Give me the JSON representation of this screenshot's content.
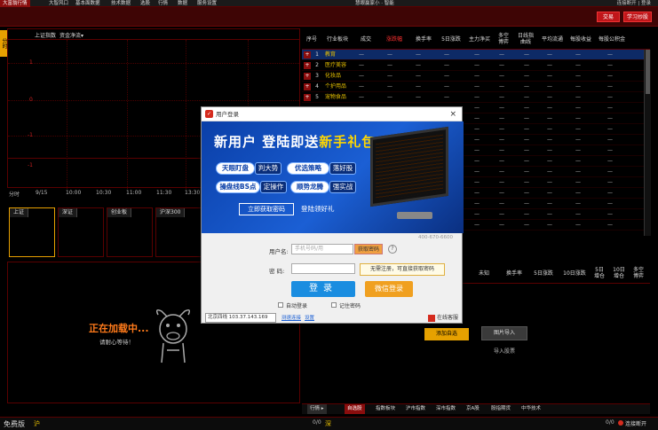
{
  "menu": {
    "items": [
      "大富翁行情",
      "大智风口",
      "基本面数据",
      "技术数据",
      "选股",
      "行情",
      "数据",
      "服务设置"
    ],
    "window_title": "慧眼赢家小 · 智能",
    "top_right": "连接断开 | 登录"
  },
  "banner": {
    "btn_trade": "交易",
    "btn_study": "学习炒股"
  },
  "left_tab": "分时",
  "chart": {
    "header_left": "上证指数",
    "header_mid": "资金净流▾",
    "ylabels": [
      "1",
      "0",
      "-1",
      "-1"
    ],
    "time_labels": [
      "分时",
      "9/15",
      "10:00",
      "10:30",
      "11:00",
      "11:30",
      "13:30"
    ]
  },
  "index_tabs": [
    "上证",
    "深证",
    "创业板",
    "沪深300"
  ],
  "table": {
    "headers": [
      "序号",
      "行业板块",
      "成交",
      "涨跌幅",
      "换手率",
      "5日涨跌",
      "主力净买",
      "多空\n博弈",
      "日线指\n曲线",
      "平均流通",
      "每股收益",
      "每股公积金"
    ],
    "active_header": 3,
    "rows": [
      {
        "no": "1",
        "name": "教育"
      },
      {
        "no": "2",
        "name": "医疗美容"
      },
      {
        "no": "3",
        "name": "化妆品"
      },
      {
        "no": "4",
        "name": "个护用品"
      },
      {
        "no": "5",
        "name": "宠物食品"
      }
    ],
    "dash": "—"
  },
  "table2": {
    "headers": [
      "未知",
      "换手率",
      "5日涨跌",
      "10日涨跌",
      "5日\n增仓",
      "10日\n增仓",
      "多空\n博弈"
    ]
  },
  "right_bottom": {
    "add_watch": "添加自选",
    "import_img": "图片导入",
    "import_label": "导入股票"
  },
  "loading": {
    "title": "正在加载中...",
    "sub": "请耐心等待！"
  },
  "tabbar": {
    "left": "行情 ▸",
    "items": [
      "自选股",
      "指数板块",
      "沪市指数",
      "深市指数",
      "京A股",
      "股指期货",
      "中华技术"
    ],
    "active": 0
  },
  "status": {
    "left": "免费版",
    "sh": "沪",
    "sz": "深",
    "right": "连接断开",
    "counter_l": "0/0",
    "counter_r": "0/0"
  },
  "dialog": {
    "title": "用户登录",
    "close": "×",
    "promo_title_a": "新用户  登陆即送",
    "promo_title_b": "新手礼包",
    "pills": [
      "天眼盯盘",
      "判大势",
      "优选策略",
      "落好股",
      "操盘线BS点",
      "定操作",
      "顺势龙腾",
      "强实战"
    ],
    "get_pwd": "立即获取密码",
    "gift": "登陆领好礼",
    "phone": "400-670-6600",
    "user_label": "用户名:",
    "user_placeholder": "手机号码/用",
    "get_code": "获取密码",
    "help": "?",
    "pwd_label": "密   码:",
    "pwd_placeholder": "",
    "tip": "无需注册，可直接获取密码",
    "login": "登录",
    "wechat_login": "微信登录",
    "auto_login": "自动登录",
    "remember_pwd": "记住密码",
    "server": "北京四线 103.37.143.169",
    "link_speed": "测速连接",
    "link_settings": "设置",
    "online": "在线客服"
  },
  "colors": {
    "accent_red": "#c0161a",
    "brand_blue": "#1a8de0",
    "orange": "#e6a100"
  }
}
